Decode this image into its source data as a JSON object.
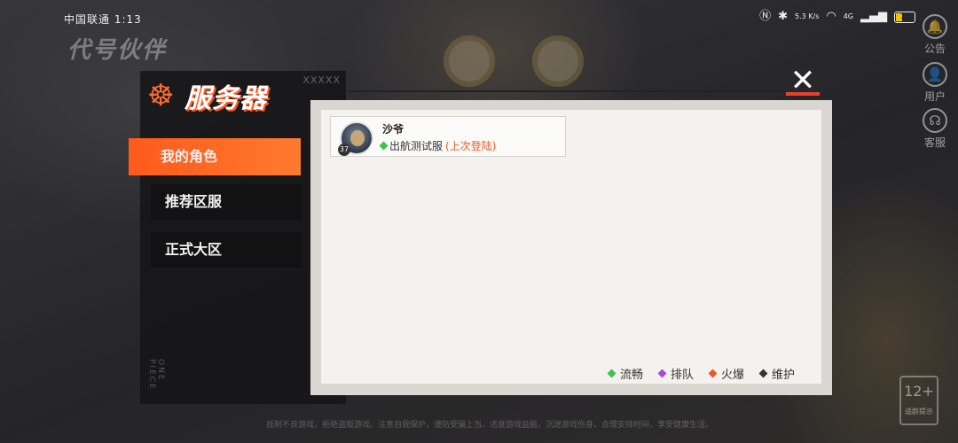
{
  "status_bar": {
    "carrier": "中国联通 1:13",
    "network_speed": "5.3\nK/s",
    "signal_type": "4G",
    "battery": "13"
  },
  "game": {
    "logo_text": "代号伙伴"
  },
  "side_buttons": [
    {
      "label": "公告",
      "icon": "bell-icon"
    },
    {
      "label": "用户",
      "icon": "user-icon"
    },
    {
      "label": "客服",
      "icon": "headset-icon"
    }
  ],
  "panel": {
    "title": "服务器",
    "decor_marks": "XXXXX",
    "vertical_text": "ONE PIECE"
  },
  "menu": [
    {
      "label": "我的角色",
      "active": true
    },
    {
      "label": "推荐区服",
      "active": false
    },
    {
      "label": "正式大区",
      "active": false
    }
  ],
  "characters": [
    {
      "name": "沙爷",
      "level": "37",
      "server": "出航测试服",
      "server_status": "流畅",
      "tag": "(上次登陆)"
    }
  ],
  "legend": [
    {
      "label": "流畅",
      "color": "#3cc44a"
    },
    {
      "label": "排队",
      "color": "#a64ad8"
    },
    {
      "label": "火爆",
      "color": "#f0542a"
    },
    {
      "label": "维护",
      "color": "#333333"
    }
  ],
  "footer": {
    "notice": "抵制不良游戏，拒绝盗版游戏。注意自我保护，谨防受骗上当。适度游戏益脑，沉迷游戏伤身。合理安排时间，享受健康生活。",
    "age_rating": "12+",
    "age_rating_sub": "适龄提示"
  },
  "colors": {
    "accent": "#ff5a1c",
    "close_bar": "#e8402a"
  }
}
